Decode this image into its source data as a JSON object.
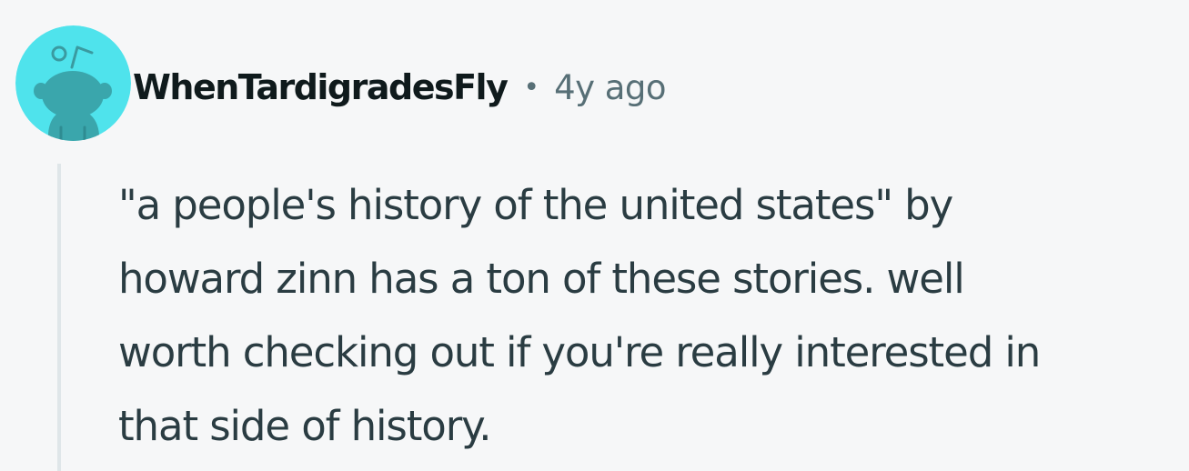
{
  "comment": {
    "author": {
      "username": "WhenTardigradesFly",
      "avatar_icon": "snoo-avatar-icon",
      "avatar_color": "#4fe3ec"
    },
    "separator": "•",
    "timestamp": "4y ago",
    "body": "\"a people's history of the united states\" by\nhoward zinn has a ton of these stories. well\nworth checking out if you're really interested in\nthat side of history."
  },
  "colors": {
    "background": "#f6f7f8",
    "username": "#0f1a1c",
    "meta": "#576f76",
    "body_text": "#2a3c42",
    "thread_line": "#dfe6e9"
  }
}
